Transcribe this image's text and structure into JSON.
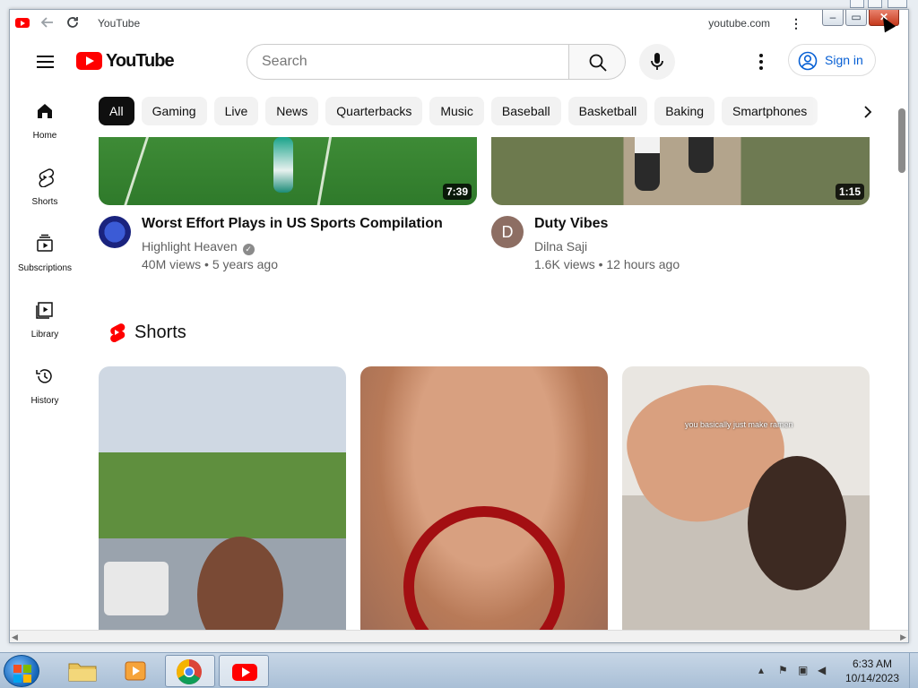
{
  "window": {
    "title": "YouTube",
    "origin": "youtube.com",
    "menu_label": "⋮"
  },
  "masthead": {
    "logo_text": "YouTube",
    "search_placeholder": "Search",
    "signin_label": "Sign in"
  },
  "sidebar": {
    "items": [
      {
        "label": "Home",
        "icon": "home-icon"
      },
      {
        "label": "Shorts",
        "icon": "shorts-icon"
      },
      {
        "label": "Subscriptions",
        "icon": "subscriptions-icon"
      },
      {
        "label": "Library",
        "icon": "library-icon"
      },
      {
        "label": "History",
        "icon": "history-icon"
      }
    ]
  },
  "chips": [
    "All",
    "Gaming",
    "Live",
    "News",
    "Quarterbacks",
    "Music",
    "Baseball",
    "Basketball",
    "Baking",
    "Smartphones"
  ],
  "videos": [
    {
      "title": "Worst Effort Plays in US Sports Compilation",
      "channel": "Highlight Heaven",
      "verified": true,
      "views": "40M views",
      "age": "5 years ago",
      "duration": "7:39"
    },
    {
      "title": "Duty Vibes",
      "channel": "Dilna Saji",
      "avatar_letter": "D",
      "views": "1.6K views",
      "age": "12 hours ago",
      "duration": "1:15"
    }
  ],
  "shorts": {
    "heading": "Shorts",
    "items": [
      {
        "caption": ""
      },
      {
        "caption": ""
      },
      {
        "caption": "you basically just make ramen"
      }
    ]
  },
  "taskbar": {
    "time": "6:33 AM",
    "date": "10/14/2023"
  },
  "colors": {
    "brand_red": "#ff0000",
    "link_blue": "#065fd4",
    "chip_active": "#0f0f0f",
    "chip_bg": "#f2f2f2"
  }
}
